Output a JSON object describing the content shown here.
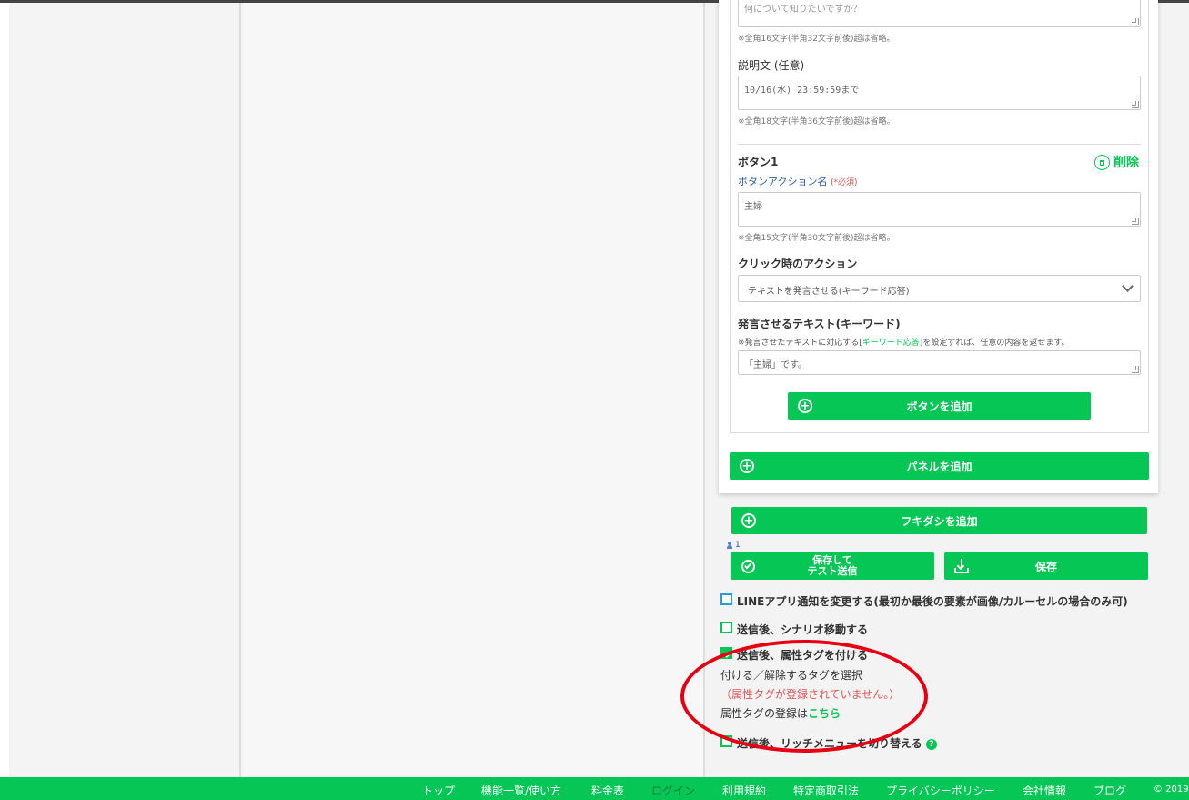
{
  "panel": {
    "title_placeholder": "何について知りたいですか？",
    "title_note": "※全角16文字(半角32文字前後)超は省略。",
    "desc_label": "説明文 (任意)",
    "desc_value": "10/16(水) 23:59:59まで",
    "desc_note": "※全角18文字(半角36文字前後)超は省略。",
    "button_title": "ボタン1",
    "delete_label": "削除",
    "action_name_label": "ボタンアクション名",
    "required_mark": "(*必須)",
    "action_name_value": "主婦",
    "action_name_note": "※全角15文字(半角30文字前後)超は省略。",
    "click_action_label": "クリック時のアクション",
    "click_action_value": "テキストを発言させる(キーワード応答)",
    "speak_text_label": "発言させるテキスト(キーワード)",
    "speak_note_pre": "※発言させたテキストに対応する[",
    "speak_note_link": "キーワード応答",
    "speak_note_post": "]を設定すれば、任意の内容を返せます。",
    "speak_text_value": "「主婦」です。",
    "add_button_label": "ボタンを追加",
    "add_panel_label": "パネルを追加"
  },
  "actions": {
    "add_fukidashi_label": "フキダシを追加",
    "user_count": "1",
    "save_test_label_1": "保存して",
    "save_test_label_2": "テスト送信",
    "save_label": "保存"
  },
  "options": {
    "line_notify_label": "LINEアプリ通知を変更する(最初か最後の要素が画像/カルーセルの場合のみ可)",
    "scenario_label": "送信後、シナリオ移動する",
    "tag_label": "送信後、属性タグを付ける",
    "tag_select_label": "付ける／解除するタグを選択",
    "tag_none_warning": "（属性タグが登録されていません。）",
    "tag_register_pre": "属性タグの登録は",
    "tag_register_link": "こちら",
    "richmenu_label": "送信後、リッチメニューを切り替える"
  },
  "footer": {
    "links": [
      "トップ",
      "機能一覧/使い方",
      "料金表",
      "ログイン",
      "利用規約",
      "特定商取引法",
      "プライバシーポリシー",
      "会社情報",
      "ブログ"
    ],
    "copyright": "© 2019"
  },
  "colors": {
    "accent": "#06c755",
    "annotation": "#e60012"
  }
}
